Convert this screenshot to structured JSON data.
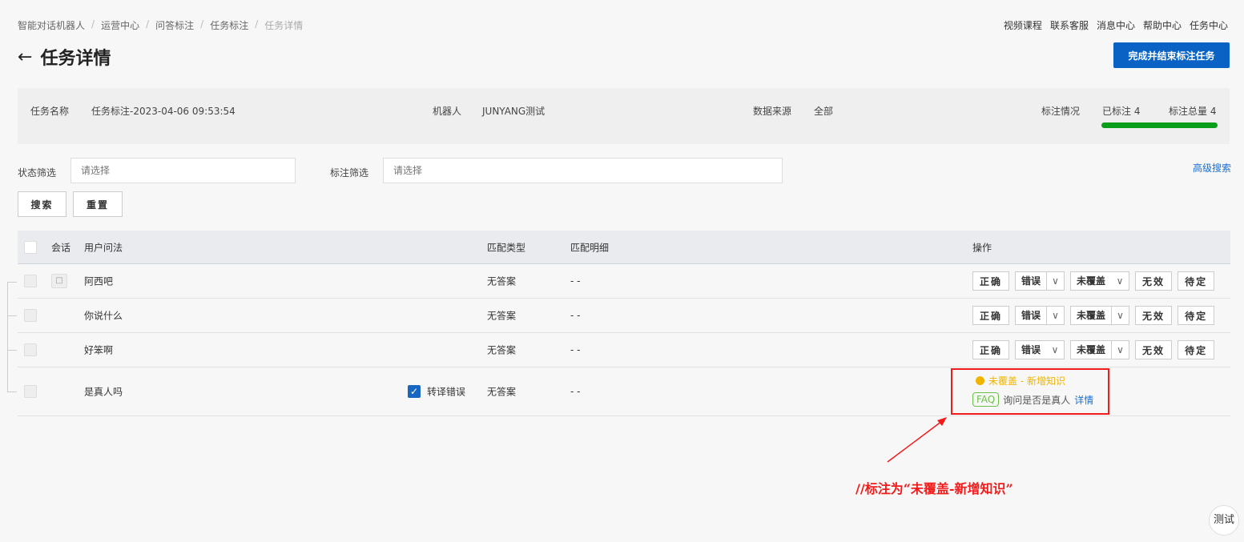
{
  "breadcrumb": [
    "智能对话机器人",
    "运营中心",
    "问答标注",
    "任务标注",
    "任务详情"
  ],
  "topnav": [
    "视频课程",
    "联系客服",
    "消息中心",
    "帮助中心",
    "任务中心"
  ],
  "title": "任务详情",
  "finish_button": "完成并结束标注任务",
  "info": {
    "task_name_label": "任务名称",
    "task_name": "任务标注-2023-04-06 09:53:54",
    "robot_label": "机器人",
    "robot": "JUNYANG测试",
    "source_label": "数据来源",
    "source": "全部",
    "status_label": "标注情况",
    "labeled": "已标注 4",
    "total": "标注总量 4",
    "progress": 1.0
  },
  "filters": {
    "status_label": "状态筛选",
    "status_placeholder": "请选择",
    "mark_label": "标注筛选",
    "mark_placeholder": "请选择",
    "search": "搜索",
    "reset": "重置",
    "advanced": "高级搜索"
  },
  "table": {
    "headers": {
      "session": "会话",
      "query": "用户问法",
      "match_type": "匹配类型",
      "match_detail": "匹配明细",
      "ops": "操作"
    },
    "rows": [
      {
        "query": "阿西吧",
        "match_type": "无答案",
        "detail": "- -"
      },
      {
        "query": "你说什么",
        "match_type": "无答案",
        "detail": "- -"
      },
      {
        "query": "好笨啊",
        "match_type": "无答案",
        "detail": "- -"
      },
      {
        "query": "是真人吗",
        "match_type": "无答案",
        "detail": "- -",
        "asr_label": "转译错误"
      }
    ],
    "op_buttons": {
      "correct": "正确",
      "wrong": "错误",
      "uncovered": "未覆盖",
      "invalid": "无效",
      "pending": "待定"
    },
    "result": {
      "status": "未覆盖 - 新增知识",
      "tag": "FAQ",
      "question": "询问是否是真人",
      "detail_link": "详情"
    }
  },
  "annotation": "//标注为“未覆盖-新增知识”",
  "test_button": "测试"
}
